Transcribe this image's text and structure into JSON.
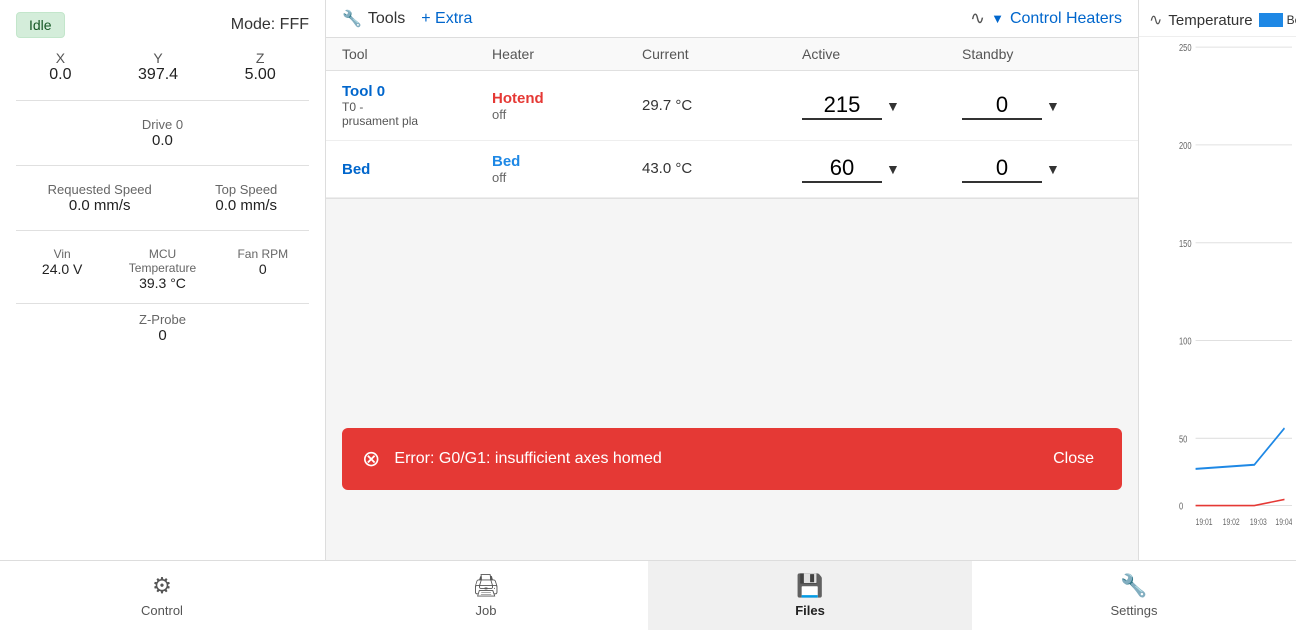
{
  "left": {
    "status": "Idle",
    "mode": "Mode: FFF",
    "coords": {
      "x_label": "X",
      "y_label": "Y",
      "z_label": "Z",
      "x_value": "0.0",
      "y_value": "397.4",
      "z_value": "5.00"
    },
    "drive": {
      "label": "Drive 0",
      "value": "0.0"
    },
    "speed": {
      "req_label": "Requested Speed",
      "top_label": "Top Speed",
      "req_value": "0.0 mm/s",
      "top_value": "0.0 mm/s"
    },
    "vin": {
      "label": "Vin",
      "value": "24.0 V"
    },
    "mcu": {
      "label": "MCU Temperature",
      "value": "39.3 °C"
    },
    "fan": {
      "label": "Fan RPM",
      "value": "0"
    },
    "zprobe": {
      "label": "Z-Probe",
      "value": "0"
    }
  },
  "toolbar": {
    "tools_label": "Tools",
    "extra_label": "+ Extra",
    "control_label": "Control Heaters",
    "tools_icon": "🔧",
    "chart_icon": "∿"
  },
  "heater_table": {
    "headers": {
      "tool": "Tool",
      "heater": "Heater",
      "current": "Current",
      "active": "Active",
      "standby": "Standby"
    },
    "rows": [
      {
        "tool_name": "Tool 0",
        "tool_sub1": "T0 -",
        "tool_sub2": "prusament pla",
        "heater_name": "Hotend",
        "heater_status": "off",
        "current": "29.7 °C",
        "active": "215",
        "standby": "0"
      },
      {
        "tool_name": "Bed",
        "tool_sub1": "",
        "tool_sub2": "",
        "heater_name": "Bed",
        "heater_status": "off",
        "current": "43.0 °C",
        "active": "60",
        "standby": "0"
      }
    ]
  },
  "error": {
    "message": "Error: G0/G1: insufficient axes homed",
    "close_label": "Close"
  },
  "chart": {
    "title": "Temperature",
    "legend_bed": "Bed",
    "y_labels": [
      "250",
      "200",
      "150",
      "100",
      "50",
      "0"
    ],
    "x_labels": [
      "19:01",
      "19:02",
      "19:03",
      "19:04"
    ]
  },
  "nav": {
    "items": [
      {
        "label": "Control",
        "icon": "⚙",
        "active": false
      },
      {
        "label": "Job",
        "icon": "🖨",
        "active": false
      },
      {
        "label": "Files",
        "icon": "📁",
        "active": true
      },
      {
        "label": "Settings",
        "icon": "🔧",
        "active": false
      }
    ]
  }
}
